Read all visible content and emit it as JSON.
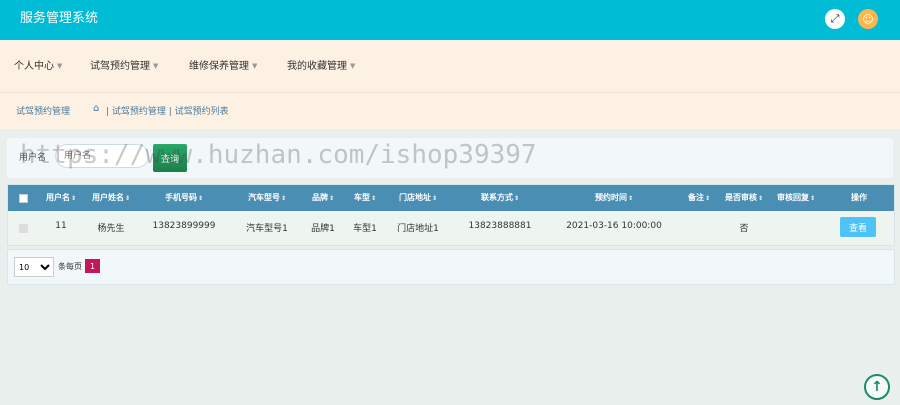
{
  "app": {
    "title": "服务管理系统"
  },
  "header": {
    "fullscreen_icon": "expand-icon",
    "user_icon": "user-avatar-icon"
  },
  "nav": {
    "items": [
      {
        "label": "个人中心"
      },
      {
        "label": "试驾预约管理"
      },
      {
        "label": "维修保养管理"
      },
      {
        "label": "我的收藏管理"
      }
    ]
  },
  "breadcrumb": {
    "section": "试驾预约管理",
    "path": "| 试驾预约管理 | 试驾预约列表"
  },
  "search": {
    "label": "用户名",
    "placeholder": "用户名",
    "button": "查询"
  },
  "watermark": "https://www.huzhan.com/ishop39397",
  "table": {
    "columns": [
      "用户名",
      "用户姓名",
      "手机号码",
      "汽车型号",
      "品牌",
      "车型",
      "门店地址",
      "联系方式",
      "预约时间",
      "备注",
      "是否审核",
      "审核回复",
      "操作"
    ],
    "rows": [
      {
        "username": "11",
        "name": "杨先生",
        "phone": "13823899999",
        "model": "汽车型号1",
        "brand": "品牌1",
        "type": "车型1",
        "store": "门店地址1",
        "contact": "13823888881",
        "time": "2021-03-16 10:00:00",
        "remark": "",
        "audited": "否",
        "reply": "",
        "action": "查看"
      }
    ]
  },
  "pager": {
    "page_size": "10",
    "page_size_options": [
      "10"
    ],
    "per_page_label": "条每页",
    "current_page": "1"
  },
  "colors": {
    "header": "#00bcd4",
    "nav_bg": "#fdf1e3",
    "table_header": "#4a8fb3",
    "view_button": "#4fc3f7",
    "active_page": "#c2185b"
  }
}
